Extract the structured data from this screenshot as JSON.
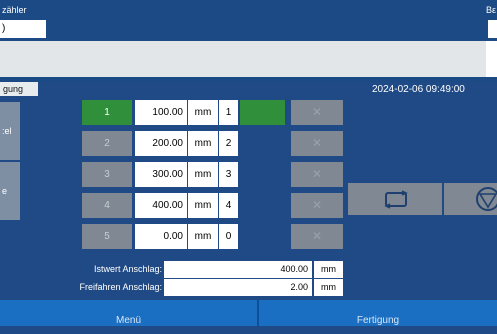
{
  "header": {
    "counter_label": "zähler",
    "counter_value": ")",
    "right_label": "Bε"
  },
  "tab": {
    "label": "gung"
  },
  "timestamp": "2024-02-06 09:49:00",
  "side_buttons": [
    {
      "label": ":el"
    },
    {
      "label": "e"
    }
  ],
  "steps": [
    {
      "num": "1",
      "value": "100.00",
      "unit": "mm",
      "slot": "1",
      "active": true
    },
    {
      "num": "2",
      "value": "200.00",
      "unit": "mm",
      "slot": "2",
      "active": false
    },
    {
      "num": "3",
      "value": "300.00",
      "unit": "mm",
      "slot": "3",
      "active": false
    },
    {
      "num": "4",
      "value": "400.00",
      "unit": "mm",
      "slot": "4",
      "active": false
    },
    {
      "num": "5",
      "value": "0.00",
      "unit": "mm",
      "slot": "0",
      "active": false
    }
  ],
  "readouts": {
    "istwert_label": "Istwert Anschlag:",
    "istwert_value": "400.00",
    "istwert_unit": "mm",
    "freifahren_label": "Freifahren Anschlag:",
    "freifahren_value": "2.00",
    "freifahren_unit": "mm"
  },
  "bottom_nav": {
    "menu_label": "Menü",
    "production_label": "Fertigung"
  },
  "colors": {
    "background": "#1f4a86",
    "active_green": "#2f8f3a",
    "bottom_bar": "#1a6fc2",
    "gray_button": "#7f8893"
  },
  "icons": {
    "delete": "close-x-icon",
    "swap": "loop-arrows-icon",
    "stop": "stop-triangle-circle-icon"
  }
}
